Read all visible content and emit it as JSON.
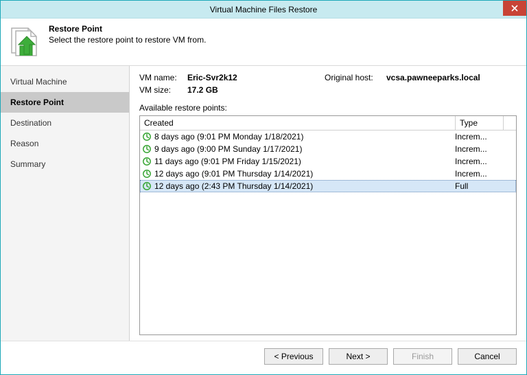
{
  "window": {
    "title": "Virtual Machine Files Restore"
  },
  "header": {
    "title": "Restore Point",
    "subtitle": "Select the restore point to restore VM from."
  },
  "sidebar": {
    "items": [
      {
        "label": "Virtual Machine",
        "active": false
      },
      {
        "label": "Restore Point",
        "active": true
      },
      {
        "label": "Destination",
        "active": false
      },
      {
        "label": "Reason",
        "active": false
      },
      {
        "label": "Summary",
        "active": false
      }
    ]
  },
  "info": {
    "vm_name_label": "VM name:",
    "vm_name_value": "Eric-Svr2k12",
    "vm_size_label": "VM size:",
    "vm_size_value": "17.2 GB",
    "orig_host_label": "Original host:",
    "orig_host_value": "vcsa.pawneeparks.local"
  },
  "table": {
    "caption": "Available restore points:",
    "columns": {
      "created": "Created",
      "type": "Type"
    },
    "rows": [
      {
        "created": "8 days ago (9:01 PM Monday 1/18/2021)",
        "type": "Increm...",
        "selected": false
      },
      {
        "created": "9 days ago (9:00 PM Sunday 1/17/2021)",
        "type": "Increm...",
        "selected": false
      },
      {
        "created": "11 days ago (9:01 PM Friday 1/15/2021)",
        "type": "Increm...",
        "selected": false
      },
      {
        "created": "12 days ago (9:01 PM Thursday 1/14/2021)",
        "type": "Increm...",
        "selected": false
      },
      {
        "created": "12 days ago (2:43 PM Thursday 1/14/2021)",
        "type": "Full",
        "selected": true
      }
    ]
  },
  "buttons": {
    "previous": "< Previous",
    "next": "Next >",
    "finish": "Finish",
    "cancel": "Cancel"
  }
}
